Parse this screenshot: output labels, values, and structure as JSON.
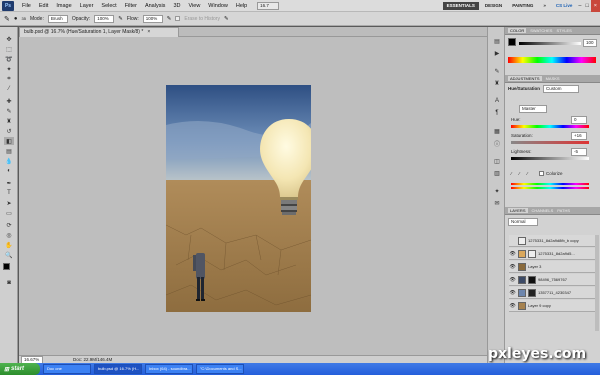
{
  "app": {
    "logo": "Ps",
    "menu": [
      "File",
      "Edit",
      "Image",
      "Layer",
      "Select",
      "Filter",
      "Analysis",
      "3D",
      "View",
      "Window",
      "Help"
    ],
    "zoom": "16.7",
    "workspaces": [
      "ESSENTIALS",
      "DESIGN",
      "PAINTING"
    ],
    "more": "»",
    "cslive": "CS Live"
  },
  "options": {
    "mode_label": "Mode:",
    "mode_value": "Brush",
    "opacity_label": "Opacity:",
    "opacity_value": "100%",
    "flow_label": "Flow:",
    "flow_value": "100%",
    "erase_history": "Erase to History"
  },
  "document": {
    "tab_title": "bulb.psd @ 16.7% (Hue/Saturation 1, Layer Mask/8) *",
    "close": "×",
    "status_zoom": "16.67%",
    "status_doc": "Doc: 22.9M/146.4M"
  },
  "panels": {
    "color_tabs": [
      "COLOR",
      "SWATCHES",
      "STYLES"
    ],
    "color_value": "100",
    "adj_tabs": [
      "ADJUSTMENTS",
      "MASKS"
    ],
    "hue_sat": {
      "title": "Hue/Saturation",
      "preset": "Custom",
      "channel": "Master",
      "hue_label": "Hue:",
      "hue": "0",
      "sat_label": "Saturation:",
      "sat": "+16",
      "light_label": "Lightness:",
      "light": "-5",
      "colorize": "Colorize"
    },
    "layers_tabs": [
      "LAYERS",
      "CHANNELS",
      "PATHS"
    ],
    "blend": "Normal",
    "layers": [
      {
        "name": "1275331_8d2a9d8fb_b copy",
        "vis": false,
        "sel": false
      },
      {
        "name": "1275331_8d2a9d5...",
        "vis": true,
        "sel": false
      },
      {
        "name": "Layer 3",
        "vis": true,
        "sel": false
      },
      {
        "name": "98496_7569767",
        "vis": true,
        "sel": false
      },
      {
        "name": "1357711_4230347",
        "vis": true,
        "sel": false
      },
      {
        "name": "Layer 9 copy",
        "vis": true,
        "sel": false
      }
    ]
  },
  "taskbar": {
    "start": "start",
    "tasks": [
      "Doc one",
      "bulb.psd @ 16.7% (H...",
      "Inbox (64) - soundbra...",
      "\"C:\\Documents and S..."
    ]
  },
  "watermark": "pxleyes.com"
}
